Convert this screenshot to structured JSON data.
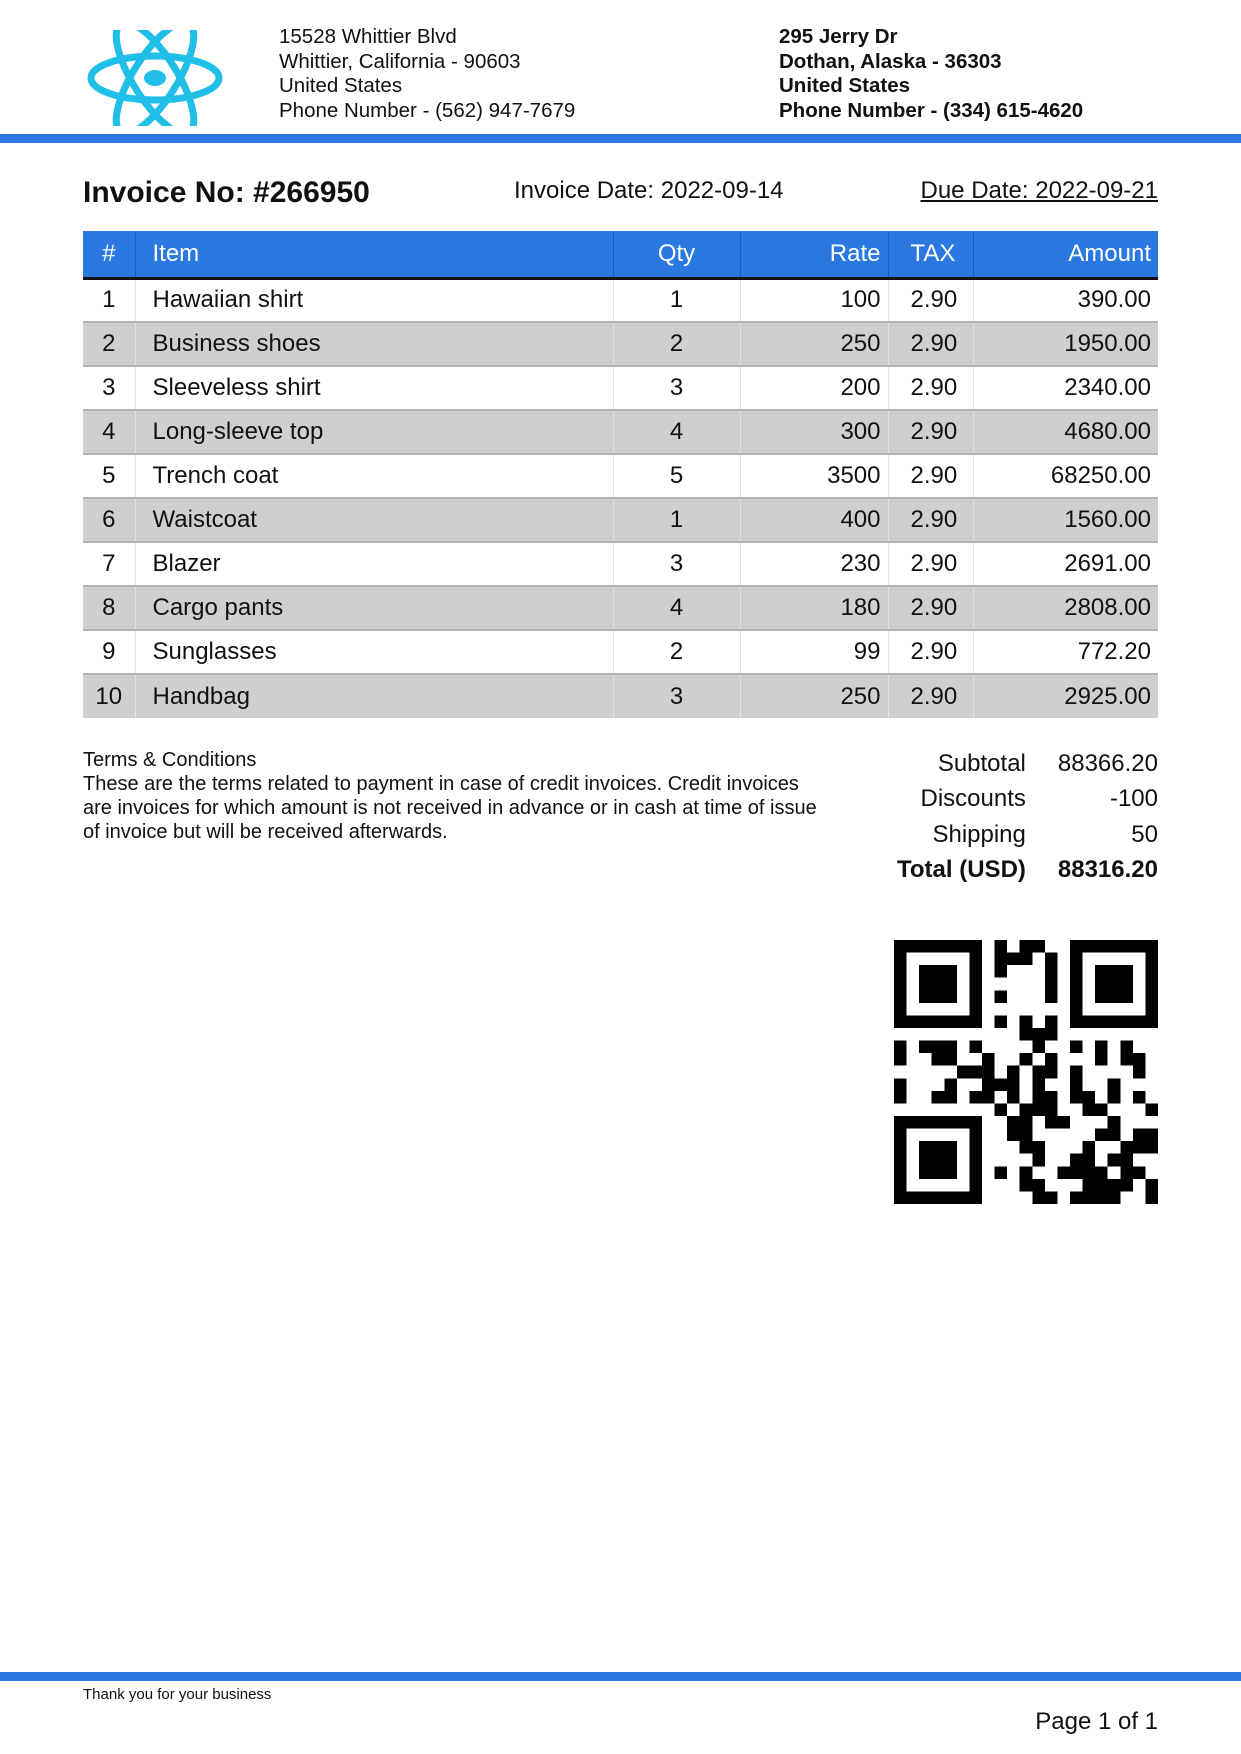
{
  "logo": {
    "icon": "atom-logo-icon",
    "color": "#1fbfe8"
  },
  "sender": {
    "line1": "15528 Whittier Blvd",
    "line2": "Whittier, California - 90603",
    "line3": "United States",
    "line4": "Phone Number - (562) 947-7679"
  },
  "recipient": {
    "line1": "295 Jerry Dr",
    "line2": "Dothan, Alaska - 36303",
    "line3": "United States",
    "line4": "Phone Number - (334) 615-4620"
  },
  "invoice": {
    "number": "Invoice No: #266950",
    "date": "Invoice Date: 2022-09-14",
    "due": "Due Date: 2022-09-21"
  },
  "table": {
    "headers": [
      "#",
      "Item",
      "Qty",
      "Rate",
      "TAX",
      "Amount"
    ],
    "rows": [
      [
        "1",
        "Hawaiian shirt",
        "1",
        "100",
        "2.90",
        "390.00"
      ],
      [
        "2",
        "Business shoes",
        "2",
        "250",
        "2.90",
        "1950.00"
      ],
      [
        "3",
        "Sleeveless shirt",
        "3",
        "200",
        "2.90",
        "2340.00"
      ],
      [
        "4",
        "Long-sleeve top",
        "4",
        "300",
        "2.90",
        "4680.00"
      ],
      [
        "5",
        "Trench coat",
        "5",
        "3500",
        "2.90",
        "68250.00"
      ],
      [
        "6",
        "Waistcoat",
        "1",
        "400",
        "2.90",
        "1560.00"
      ],
      [
        "7",
        "Blazer",
        "3",
        "230",
        "2.90",
        "2691.00"
      ],
      [
        "8",
        "Cargo pants",
        "4",
        "180",
        "2.90",
        "2808.00"
      ],
      [
        "9",
        "Sunglasses",
        "2",
        "99",
        "2.90",
        "772.20"
      ],
      [
        "10",
        "Handbag",
        "3",
        "250",
        "2.90",
        "2925.00"
      ]
    ]
  },
  "terms": {
    "title": "Terms & Conditions",
    "text": "These are the terms related to payment in case of credit invoices. Credit invoices are invoices for which amount is not received in advance or in cash at time of issue of invoice but will be received afterwards."
  },
  "totals": {
    "subtotal_label": "Subtotal",
    "subtotal": "88366.20",
    "discounts_label": "Discounts",
    "discounts": "-100",
    "shipping_label": "Shipping",
    "shipping": "50",
    "total_label": "Total (USD)",
    "total": "88316.20"
  },
  "qr": {
    "icon": "qr-code-icon"
  },
  "footer": {
    "thanks": "Thank you for your business",
    "page": "Page 1 of 1"
  },
  "colors": {
    "accent": "#2a78e0",
    "row_alt": "#cfcfcf"
  }
}
